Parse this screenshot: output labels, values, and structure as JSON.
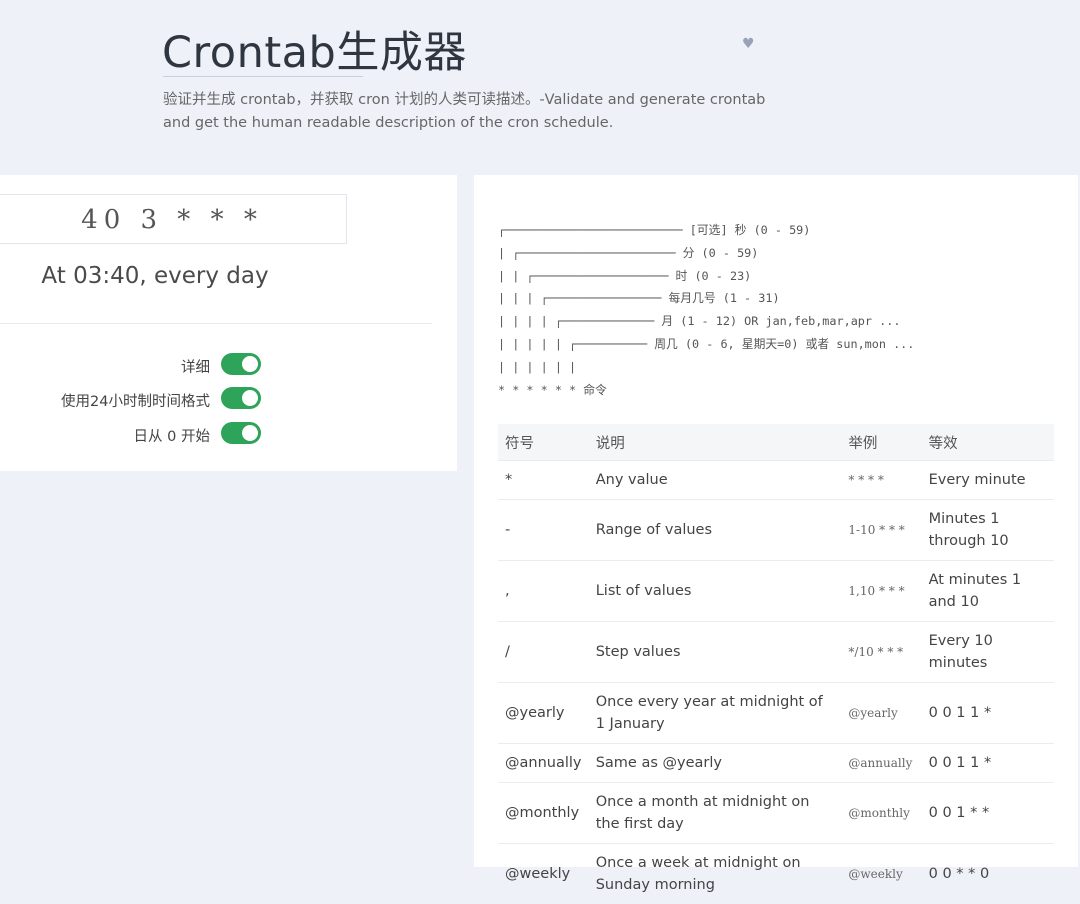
{
  "header": {
    "title": "Crontab生成器",
    "subtitle": "验证并生成 crontab，并获取 cron 计划的人类可读描述。-Validate and generate crontab and get the human readable description of the cron schedule."
  },
  "editor": {
    "expression": "40 3 * * *",
    "description": "At 03:40, every day"
  },
  "options": [
    {
      "label": "详细",
      "enabled": true
    },
    {
      "label": "使用24小时制时间格式",
      "enabled": true
    },
    {
      "label": "日从 0 开始",
      "enabled": true
    }
  ],
  "diagram_lines": [
    "┌───────────────────────── [可选] 秒 (0 - 59)",
    "| ┌────────────────────── 分 (0 - 59)",
    "| | ┌─────────────────── 时 (0 - 23)",
    "| | | ┌──────────────── 每月几号 (1 - 31)",
    "| | | | ┌───────────── 月 (1 - 12) OR jan,feb,mar,apr ...",
    "| | | | | ┌────────── 周几 (0 - 6, 星期天=0) 或者 sun,mon ...",
    "| | | | | |",
    "* * * * * * 命令"
  ],
  "table": {
    "headers": [
      "符号",
      "说明",
      "举例",
      "等效"
    ],
    "rows": [
      [
        "*",
        "Any value",
        "* * * *",
        "Every minute"
      ],
      [
        "-",
        "Range of values",
        "1-10 * * *",
        "Minutes 1 through 10"
      ],
      [
        ",",
        "List of values",
        "1,10 * * *",
        "At minutes 1 and 10"
      ],
      [
        "/",
        "Step values",
        "*/10 * * *",
        "Every 10 minutes"
      ],
      [
        "@yearly",
        "Once every year at midnight of 1 January",
        "@yearly",
        "0 0 1 1 *"
      ],
      [
        "@annually",
        "Same as @yearly",
        "@annually",
        "0 0 1 1 *"
      ],
      [
        "@monthly",
        "Once a month at midnight on the first day",
        "@monthly",
        "0 0 1 * *"
      ],
      [
        "@weekly",
        "Once a week at midnight on Sunday morning",
        "@weekly",
        "0 0 * * 0"
      ]
    ]
  },
  "colors": {
    "background": "#eef1f8",
    "toggle_on": "#2ea35a"
  }
}
